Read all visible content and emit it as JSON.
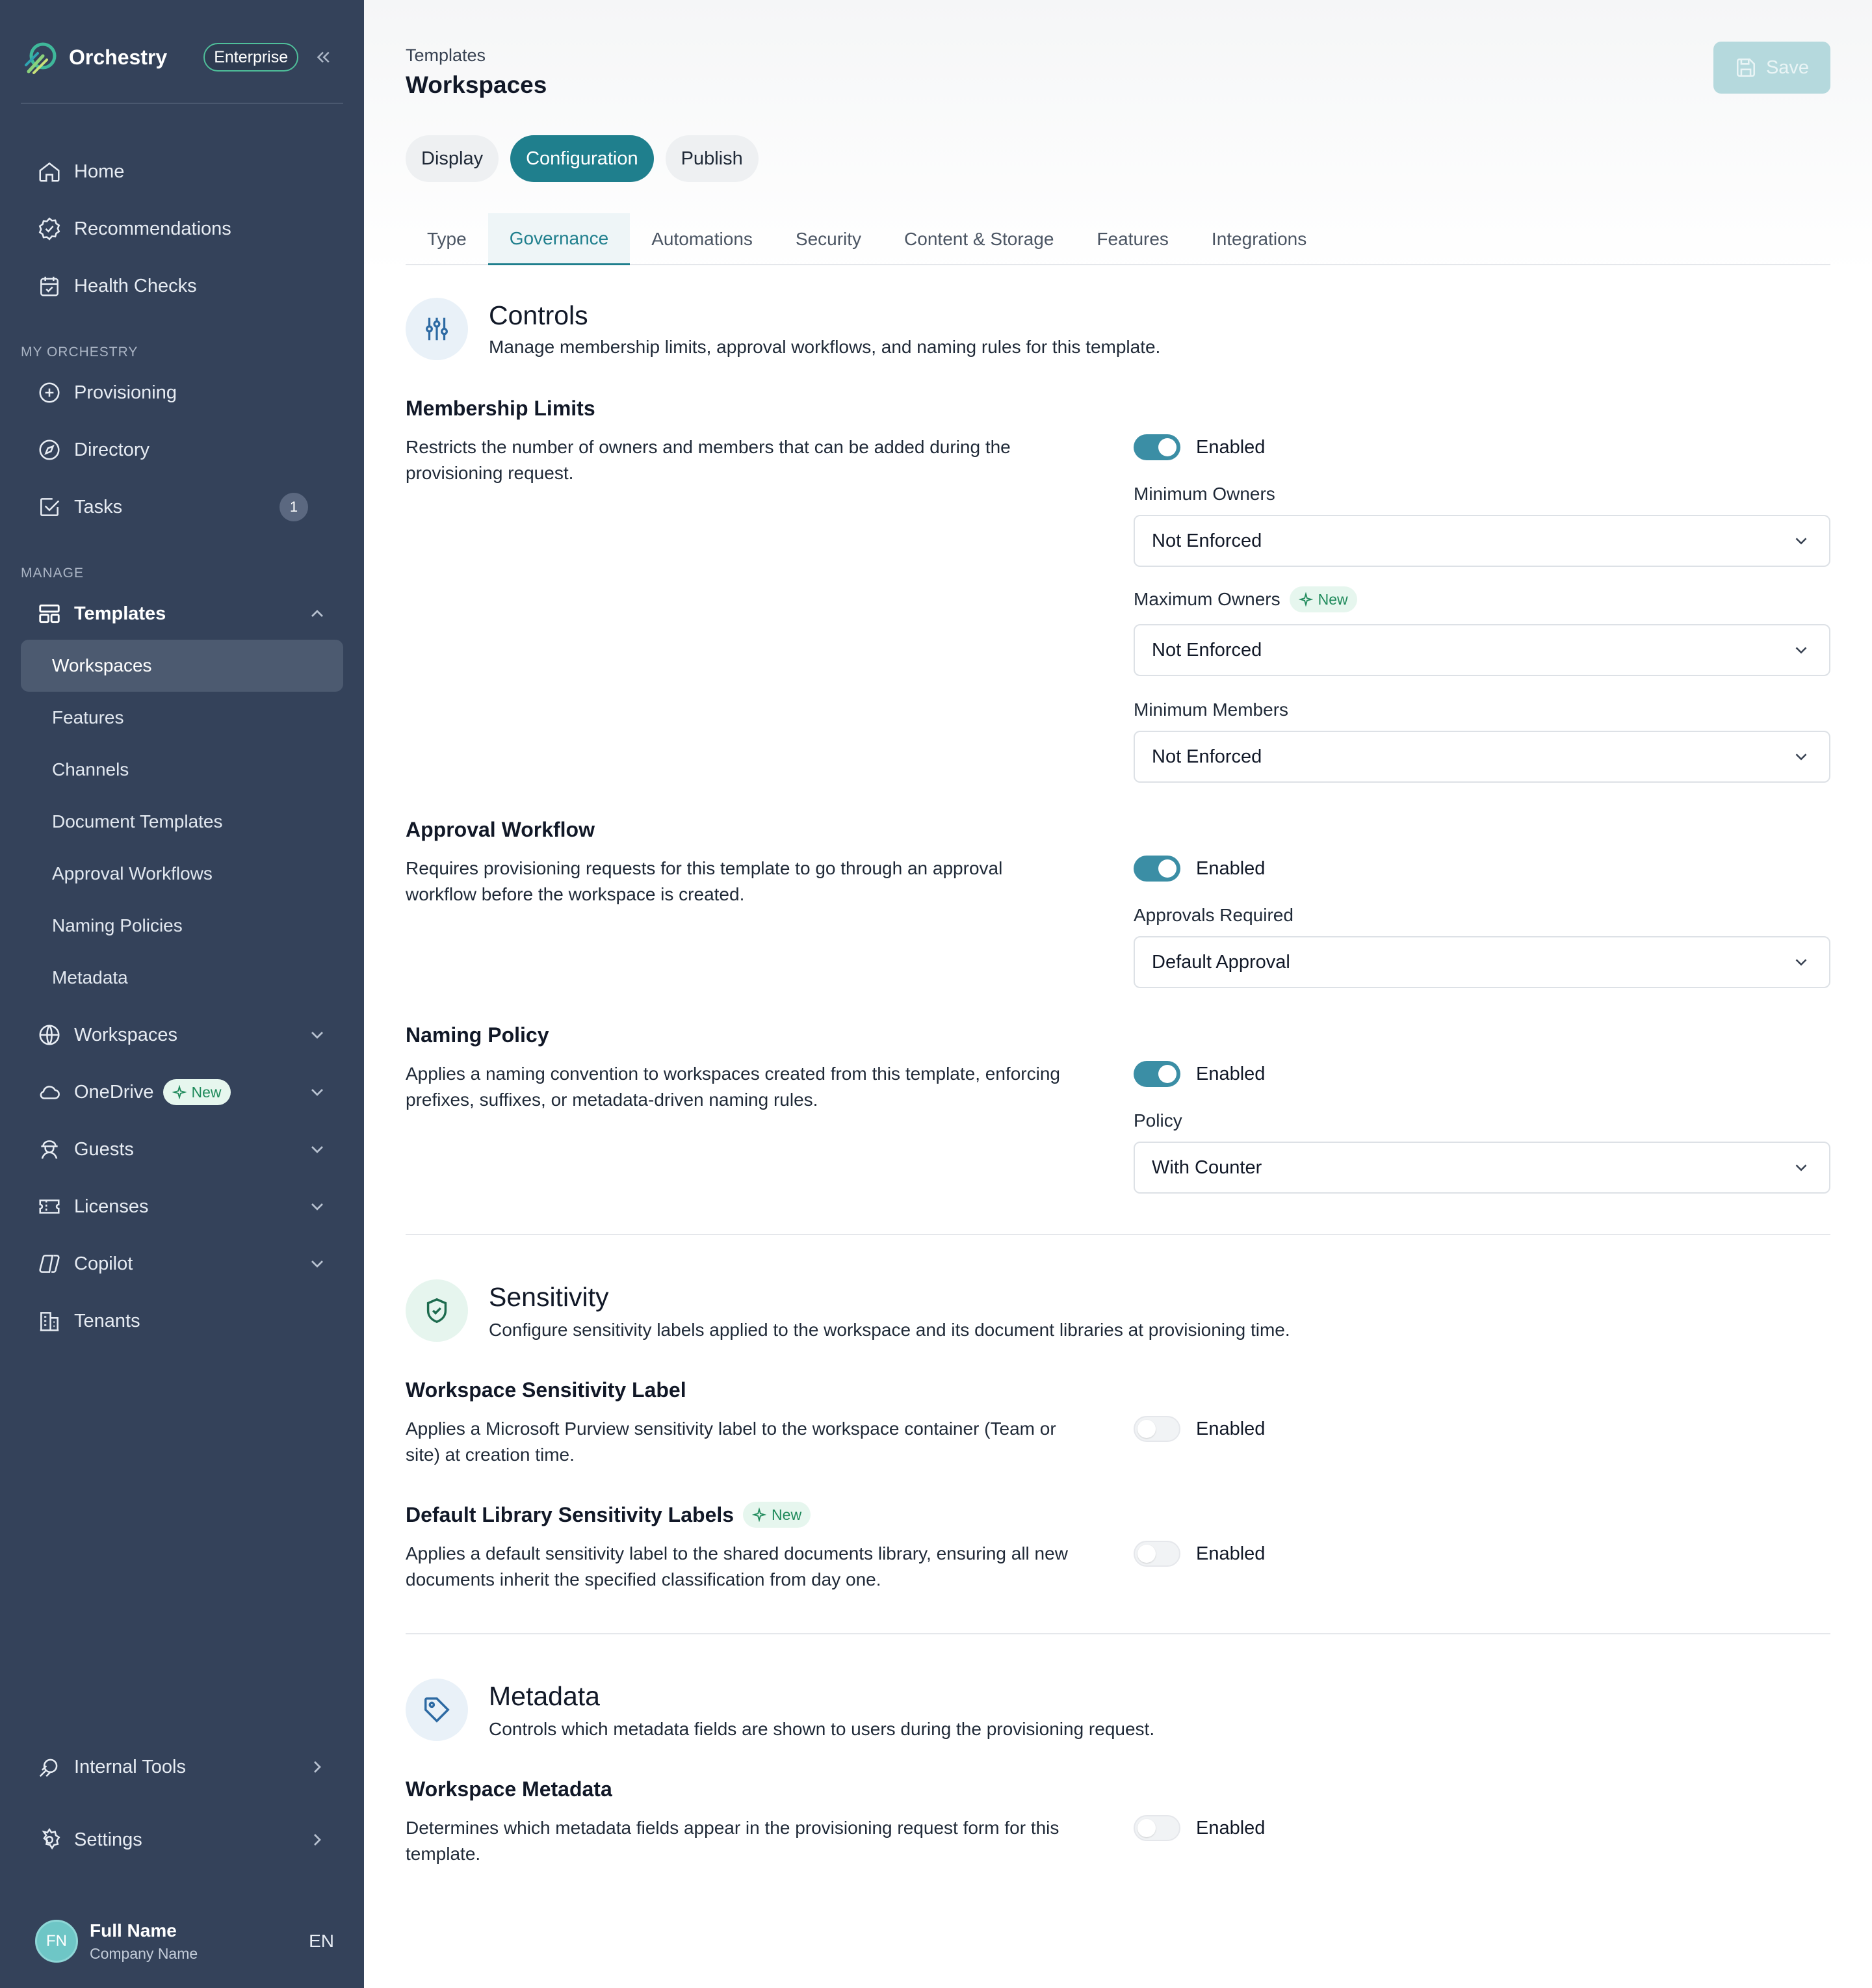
{
  "brand": {
    "name": "Orchestry",
    "plan": "Enterprise"
  },
  "sidebar": {
    "top": [
      {
        "label": "Home",
        "icon": "home-icon"
      },
      {
        "label": "Recommendations",
        "icon": "badge-check-icon"
      },
      {
        "label": "Health Checks",
        "icon": "calendar-check-icon"
      }
    ],
    "sections": {
      "my_orchestry": "MY ORCHESTRY",
      "manage": "MANAGE"
    },
    "my_orchestry": [
      {
        "label": "Provisioning",
        "icon": "plus-circle-icon"
      },
      {
        "label": "Directory",
        "icon": "compass-icon"
      },
      {
        "label": "Tasks",
        "icon": "task-check-icon",
        "count": "1"
      }
    ],
    "templates": {
      "label": "Templates",
      "children": [
        "Workspaces",
        "Features",
        "Channels",
        "Document Templates",
        "Approval Workflows",
        "Naming Policies",
        "Metadata"
      ]
    },
    "manage": [
      {
        "label": "Workspaces",
        "icon": "globe-icon"
      },
      {
        "label": "OneDrive",
        "icon": "cloud-icon",
        "badge": "New"
      },
      {
        "label": "Guests",
        "icon": "guests-icon"
      },
      {
        "label": "Licenses",
        "icon": "ticket-icon"
      },
      {
        "label": "Copilot",
        "icon": "copilot-icon"
      },
      {
        "label": "Tenants",
        "icon": "building-icon"
      }
    ],
    "bottom": [
      {
        "label": "Internal Tools",
        "icon": "tools-icon"
      },
      {
        "label": "Settings",
        "icon": "gear-icon"
      }
    ],
    "user": {
      "initials": "FN",
      "name": "Full Name",
      "company": "Company Name",
      "lang": "EN"
    }
  },
  "header": {
    "breadcrumb": "Templates",
    "title": "Workspaces",
    "save_label": "Save"
  },
  "pill_tabs": [
    "Display",
    "Configuration",
    "Publish"
  ],
  "tabs": [
    "Type",
    "Governance",
    "Automations",
    "Security",
    "Content & Storage",
    "Features",
    "Integrations"
  ],
  "controls": {
    "title": "Controls",
    "desc": "Manage membership limits, approval workflows, and naming rules for this template.",
    "membership": {
      "title": "Membership Limits",
      "desc": "Restricts the number of owners and members that can be added during the provisioning request.",
      "toggle": "Enabled",
      "min_owners_label": "Minimum Owners",
      "min_owners_value": "Not Enforced",
      "max_owners_label": "Maximum Owners",
      "max_owners_badge": "New",
      "max_owners_value": "Not Enforced",
      "min_members_label": "Minimum Members",
      "min_members_value": "Not Enforced"
    },
    "approval": {
      "title": "Approval Workflow",
      "desc": "Requires provisioning requests for this template to go through an approval workflow before the workspace is created.",
      "toggle": "Enabled",
      "field_label": "Approvals Required",
      "field_value": "Default Approval"
    },
    "naming": {
      "title": "Naming Policy",
      "desc": "Applies a naming convention to workspaces created from this template, enforcing prefixes, suffixes, or metadata-driven naming rules.",
      "toggle": "Enabled",
      "field_label": "Policy",
      "field_value": "With Counter"
    }
  },
  "sensitivity": {
    "title": "Sensitivity",
    "desc": "Configure sensitivity labels applied to the workspace and its document libraries at provisioning time.",
    "workspace_label": {
      "title": "Workspace Sensitivity Label",
      "desc": "Applies a Microsoft Purview sensitivity label to the workspace container (Team or site) at creation time.",
      "toggle": "Enabled"
    },
    "library_labels": {
      "title": "Default Library Sensitivity Labels",
      "badge": "New",
      "desc": "Applies a default sensitivity label to the shared documents library, ensuring all new documents inherit the specified classification from day one.",
      "toggle": "Enabled"
    }
  },
  "metadata": {
    "title": "Metadata",
    "desc": "Controls which metadata fields are shown to users during the provisioning request.",
    "workspace_metadata": {
      "title": "Workspace Metadata",
      "desc": "Determines which metadata fields appear in the provisioning request form for this template.",
      "toggle": "Enabled"
    }
  },
  "colors": {
    "sidebar": "#34425a",
    "accent": "#1f7f8d",
    "toggle_on": "#3b8ea5",
    "new_badge": "#1f8a5b"
  }
}
